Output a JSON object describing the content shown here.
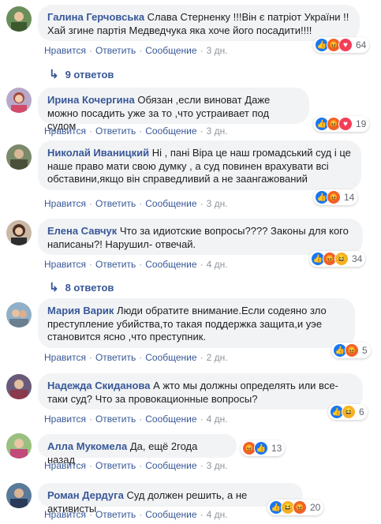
{
  "actions": {
    "like": "Нравится",
    "reply": "Ответить",
    "message": "Сообщение",
    "sep": "·"
  },
  "comments": [
    {
      "author": "Галина Герчовська",
      "text": "Слава Стерненку !!!Він є патріот України !!Хай згине партія Медведчука яка хоче його посадити!!!!",
      "time": "3 дн.",
      "count": "64",
      "reactions": [
        "like-icon",
        "angry-icon",
        "love-icon"
      ]
    },
    {
      "author": "Ирина Кочергина",
      "text": "Обязан ,если виноват Даже можно посадить уже за то ,что устраивает под судом",
      "time": "3 дн.",
      "count": "19",
      "reactions": [
        "like-icon",
        "angry-icon",
        "love-icon"
      ]
    },
    {
      "author": "Николай Иваницкий",
      "text": "Ні , пані Віра це наш громадський суд і це наше право мати свою думку , а суд повинен врахувати всі обставини,якщо він справедливий а не заангажований",
      "time": "3 дн.",
      "count": "14",
      "reactions": [
        "like-icon",
        "angry-icon"
      ]
    },
    {
      "author": "Елена Савчук",
      "text": "Что за идиотские вопросы???? Законы для кого написаны?! Нарушил- отвечай.",
      "time": "4 дн.",
      "count": "34",
      "reactions": [
        "like-icon",
        "angry-icon",
        "haha-icon"
      ]
    },
    {
      "author": "Мария Варик",
      "text": "Люди обратите внимание.Если содеяно зло преступление убийства,то такая поддержка защита,и уэе становится ясно ,что преступник.",
      "time": "2 дн.",
      "count": "5",
      "reactions": [
        "like-icon",
        "angry-icon"
      ]
    },
    {
      "author": "Надежда Скиданова",
      "text": "А жто мы должны определять или все-таки суд? Что за провокационные вопросы?",
      "time": "4 дн.",
      "count": "6",
      "reactions": [
        "like-icon",
        "haha-icon"
      ]
    },
    {
      "author": "Алла Мукомела",
      "text": "Да, ещё 2года назад",
      "time": "3 дн.",
      "count": "13",
      "reactions": [
        "angry-icon",
        "like-icon"
      ]
    },
    {
      "author": "Роман Дердуга",
      "text": "Суд должен решить, а не активисты",
      "time": "4 дн.",
      "count": "20",
      "reactions": [
        "like-icon",
        "haha-icon",
        "angry-icon"
      ]
    }
  ],
  "reply_threads": [
    {
      "label": "9 ответов"
    },
    {
      "label": "8 ответов"
    }
  ],
  "colors": {
    "link": "#385898",
    "bubble": "#f2f3f5",
    "like": "#1877f2",
    "angry": "#f0612a",
    "love": "#f33e58",
    "haha": "#f7b125"
  }
}
